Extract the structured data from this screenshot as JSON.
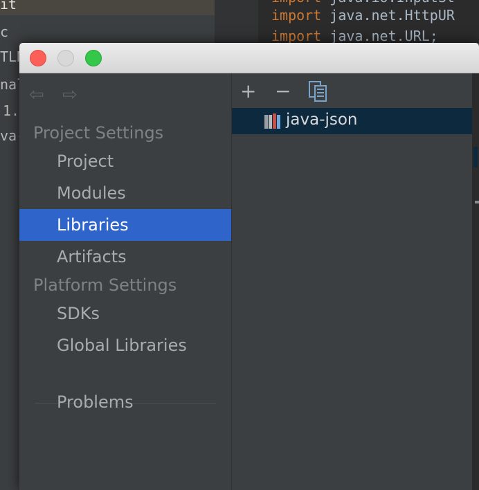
{
  "background": {
    "left_fragments": [
      "it",
      "c",
      "TLN",
      "nal",
      "1.",
      "va-"
    ],
    "code_lines": [
      {
        "keyword": "import",
        "rest": " java.io.InputSt"
      },
      {
        "keyword": "import",
        "rest": " java.net.HttpUR"
      },
      {
        "keyword": "import",
        "rest": " java.net.URL;"
      }
    ]
  },
  "dialog": {
    "nav": {
      "back_glyph": "⇦",
      "forward_glyph": "⇨"
    },
    "sections": [
      {
        "label": "Project Settings",
        "items": [
          "Project",
          "Modules",
          "Libraries",
          "Artifacts"
        ]
      },
      {
        "label": "Platform Settings",
        "items": [
          "SDKs",
          "Global Libraries"
        ]
      }
    ],
    "problems_label": "Problems",
    "selected_item": "Libraries",
    "toolbar": {
      "add": "+",
      "remove": "−"
    },
    "libraries": [
      {
        "name": "java-json",
        "icon": "library-icon"
      }
    ]
  },
  "colors": {
    "selection": "#2f65ca",
    "library_row_selection": "#0d293e",
    "keyword": "#cc7832"
  }
}
